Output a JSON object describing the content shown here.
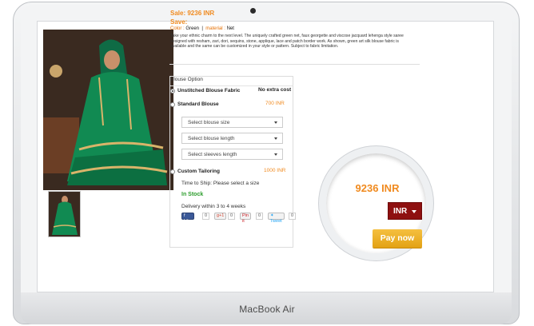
{
  "device": {
    "brand": "MacBook Air"
  },
  "product": {
    "sale": "Sale: 9236 INR",
    "save": "Save:",
    "attributes": {
      "color_key": "Color :",
      "color_value": "Green",
      "divider": "|",
      "material_key": "material :",
      "material_value": "Net"
    },
    "description": "Take your ethnic charm to the next level. The uniquely crafted green net, faux georgette and viscose jacquard lehenga style saree designed with resham, zari, dori, sequins, stone, applique, lace and patch border work. As shown, green art silk blouse fabric is available and the same can be customized in your style or pattern. Subject to fabric limitation."
  },
  "blouse": {
    "title": "Blouse Option",
    "options": [
      {
        "label": "Unstitched Blouse Fabric",
        "note": "No extra cost"
      },
      {
        "label": "Standard Blouse",
        "price": "700 INR"
      },
      {
        "label": "Custom Tailoring",
        "price": "1000 INR"
      }
    ],
    "selects": {
      "size": "Select blouse size",
      "length": "Select blouse length",
      "sleeves": "Select sleeves length"
    }
  },
  "shipping": {
    "time": "Time to Ship: Please select a size",
    "stock": "In Stock",
    "delivery": "Delivery within 3 to 4 weeks"
  },
  "social": {
    "facebook_label": "Like",
    "facebook_count": "0",
    "gplus_label": "g+1",
    "gplus_count": "0",
    "pinterest_label": "Pin it",
    "pinterest_count": "0",
    "twitter_label": "Tweet",
    "twitter_count": "0"
  },
  "purchase": {
    "price": "9236 INR",
    "currency": "INR",
    "pay_label": "Pay now"
  },
  "colors": {
    "accent": "#f08a1f",
    "currency_bg": "#8e1010",
    "pay_bg": "#e3a214",
    "stock": "#2b9c2b"
  }
}
